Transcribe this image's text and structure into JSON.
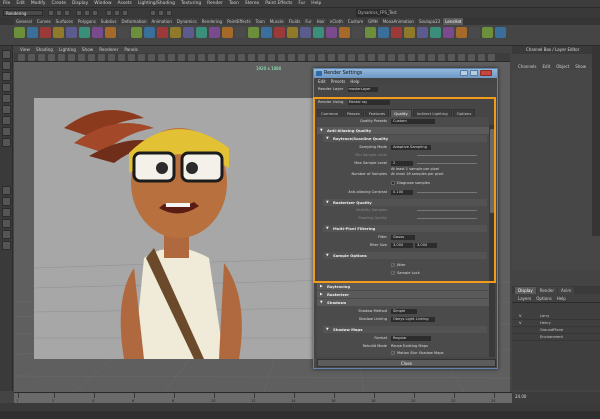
{
  "menubar": [
    "File",
    "Edit",
    "Modify",
    "Create",
    "Display",
    "Window",
    "Assets",
    "Lighting/Shading",
    "Texturing",
    "Render",
    "Toon",
    "Stereo",
    "Paint Effects",
    "Fur",
    "Help"
  ],
  "status": {
    "mode": "Rendering",
    "field": "Dynamics_FPS_Test"
  },
  "shelf_tabs": [
    "General",
    "Curves",
    "Surfaces",
    "Polygons",
    "Subdivs",
    "Deformation",
    "Animation",
    "Dynamics",
    "Rendering",
    "PaintEffects",
    "Toon",
    "Muscle",
    "Fluids",
    "Fur",
    "Hair",
    "nCloth",
    "Custom",
    "GMH",
    "MonaAnimation",
    "Soulupa23",
    "LensHat"
  ],
  "shelf_labels": [
    "",
    "",
    "",
    "",
    "",
    "",
    "",
    "",
    "",
    "",
    "",
    "",
    "",
    "",
    "",
    "",
    "",
    "",
    "",
    "",
    "",
    "",
    "",
    "",
    "",
    "",
    "",
    "",
    "",
    "",
    "",
    "",
    "",
    "",
    "",
    "",
    "",
    ""
  ],
  "viewport": {
    "menu": [
      "View",
      "Shading",
      "Lighting",
      "Show",
      "Renderer",
      "Panels"
    ],
    "resolution": "1920 x 1080"
  },
  "right_panel": {
    "header": "Channel Box / Layer Editor",
    "menu": [
      "Channels",
      "Edit",
      "Object",
      "Show"
    ]
  },
  "layers": {
    "tabs": [
      "Display",
      "Render",
      "Anim"
    ],
    "menu": [
      "Layers",
      "Options",
      "Help"
    ],
    "rows": [
      {
        "v": "V",
        "name": "Larry"
      },
      {
        "v": "V",
        "name": "Henry"
      },
      {
        "v": "",
        "name": "GroundPlane"
      },
      {
        "v": "",
        "name": "Environment"
      }
    ]
  },
  "timeline": {
    "ticks": [
      "1",
      "2",
      "4",
      "6",
      "8",
      "10",
      "12",
      "14",
      "16",
      "18",
      "20",
      "22",
      "24"
    ],
    "end": "24.00"
  },
  "render_settings": {
    "title": "Render Settings",
    "menu": [
      "Edit",
      "Presets",
      "Help"
    ],
    "render_layer_label": "Render Layer",
    "render_layer_value": "masterLayer",
    "render_using_label": "Render Using",
    "render_using_value": "Mental ray",
    "tabs": [
      "Common",
      "Passes",
      "Features",
      "Quality",
      "Indirect Lighting",
      "Options"
    ],
    "active_tab": "Quality",
    "quality_presets_label": "Quality Presets",
    "quality_presets_value": "Custom",
    "sections": {
      "anti_aliasing": "Anti-Aliasing Quality",
      "raytrace_scanline": "Raytrace/Scanline Quality",
      "rasterizer": "Rasterizer Quality",
      "multipixel": "Multi-Pixel Filtering",
      "sample_options": "Sample Options",
      "raytracing": "Raytracing",
      "rasterizer2": "Rasterizer",
      "shadows": "Shadows",
      "shadow_maps": "Shadow Maps"
    },
    "fields": {
      "sampling_mode_label": "Sampling Mode",
      "sampling_mode_value": "Adaptive Sampling",
      "min_sample_label": "Min Sample Level",
      "max_sample_label": "Max Sample Level",
      "max_sample_value": "2",
      "num_samples_label": "Number of Samples",
      "num_samples_line1": "At least 1 sample per pixel",
      "num_samples_line2": "At most 16 samples per pixel",
      "diagnose_label": "Diagnose samples",
      "aa_contrast_label": "Anti-aliasing Contrast",
      "aa_contrast_value": "0.100",
      "visibility_label": "Visibility Samples",
      "shading_label": "Shading Quality",
      "filter_label": "Filter",
      "filter_value": "Gauss",
      "filter_size_label": "Filter Size",
      "filter_size_x": "3.000",
      "filter_size_y": "3.000",
      "jitter_label": "Jitter",
      "sample_lock_label": "Sample Lock",
      "shadow_method_label": "Shadow Method",
      "shadow_method_value": "Simple",
      "shadow_linking_label": "Shadow Linking",
      "shadow_linking_value": "Obeys Light Linking",
      "format_label": "Format",
      "format_value": "Regular",
      "rebuild_label": "Rebuild Mode",
      "rebuild_value": "Reuse Existing Maps",
      "motion_blur_label": "Motion Blur Shadow Maps"
    },
    "close_label": "Close"
  },
  "colors": {
    "highlight": "#f39c1c",
    "titlebar": "#7fa6cf"
  }
}
